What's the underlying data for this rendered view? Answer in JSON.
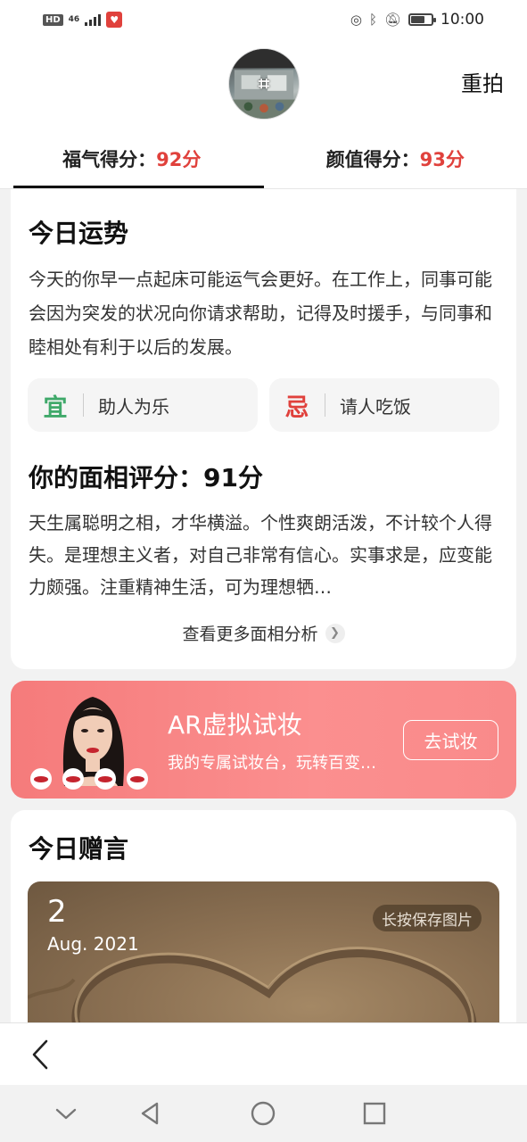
{
  "status_bar": {
    "hd": "HD",
    "network": "46",
    "time": "10:00",
    "battery_level": 0.7
  },
  "header": {
    "retake_label": "重拍",
    "avatar_icon": "crop-icon"
  },
  "tabs": [
    {
      "label": "福气得分：",
      "score": "92分",
      "active": true
    },
    {
      "label": "颜值得分：",
      "score": "93分",
      "active": false
    }
  ],
  "fortune": {
    "title": "今日运势",
    "text": "今天的你早一点起床可能运气会更好。在工作上，同事可能会因为突发的状况向你请求帮助，记得及时援手，与同事和睦相处有利于以后的发展。",
    "yi_mark": "宜",
    "yi_text": "助人为乐",
    "ji_mark": "忌",
    "ji_text": "请人吃饭"
  },
  "face": {
    "title": "你的面相评分：91分",
    "text": "天生属聪明之相，才华横溢。个性爽朗活泼，不计较个人得失。是理想主义者，对自己非常有信心。实事求是，应变能力颇强。注重精神生活，可为理想牺…",
    "more_label": "查看更多面相分析"
  },
  "ar_banner": {
    "title": "AR虚拟试妆",
    "subtitle": "我的专属试妆台，玩转百变…",
    "button": "去试妆"
  },
  "quote": {
    "title": "今日赠言",
    "day": "2",
    "month": "Aug. 2021",
    "save_label": "长按保存图片"
  },
  "colors": {
    "accent_red": "#e0413c",
    "yi_green": "#3fa96a",
    "banner_pink": "#f98a8a"
  }
}
